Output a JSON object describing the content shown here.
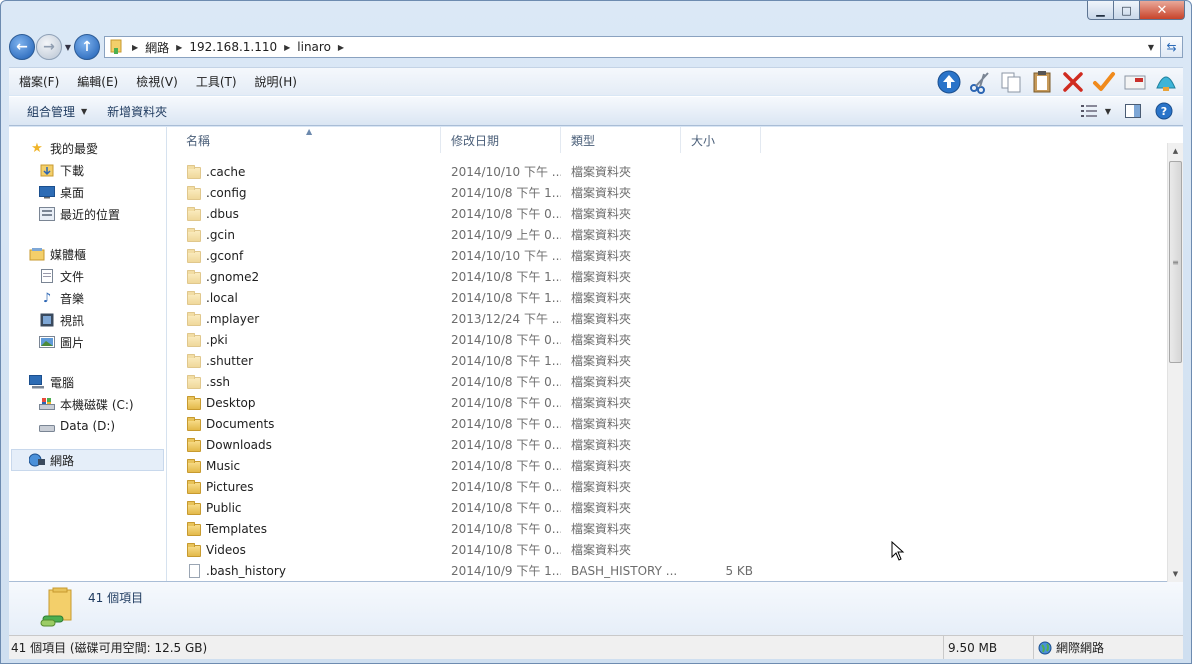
{
  "window": {
    "controls": {
      "minimize": "▁",
      "maximize": "□",
      "close": "✕"
    }
  },
  "address": {
    "crumbs": [
      "網路",
      "192.168.1.110",
      "linaro"
    ]
  },
  "menu": {
    "items": [
      "檔案(F)",
      "編輯(E)",
      "檢視(V)",
      "工具(T)",
      "說明(H)"
    ]
  },
  "toolbar": {
    "icons": [
      "up-arrow-icon",
      "cut-icon",
      "copy-icon",
      "paste-icon",
      "delete-icon",
      "check-icon",
      "mail-icon",
      "shell-icon"
    ]
  },
  "command_bar": {
    "organize": "組合管理",
    "new_folder": "新增資料夾"
  },
  "nav_pane": {
    "favorites": {
      "label": "我的最愛",
      "items": [
        "下載",
        "桌面",
        "最近的位置"
      ]
    },
    "libraries": {
      "label": "媒體櫃",
      "items": [
        "文件",
        "音樂",
        "視訊",
        "圖片"
      ]
    },
    "computer": {
      "label": "電腦",
      "items": [
        "本機磁碟 (C:)",
        "Data (D:)"
      ]
    },
    "network": {
      "label": "網路"
    }
  },
  "columns": {
    "name": "名稱",
    "date": "修改日期",
    "type": "類型",
    "size": "大小"
  },
  "files": [
    {
      "name": ".cache",
      "date": "2014/10/10 下午 ...",
      "type": "檔案資料夾",
      "size": "",
      "kind": "folder-hidden"
    },
    {
      "name": ".config",
      "date": "2014/10/8 下午 1...",
      "type": "檔案資料夾",
      "size": "",
      "kind": "folder-hidden"
    },
    {
      "name": ".dbus",
      "date": "2014/10/8 下午 0...",
      "type": "檔案資料夾",
      "size": "",
      "kind": "folder-hidden"
    },
    {
      "name": ".gcin",
      "date": "2014/10/9 上午 0...",
      "type": "檔案資料夾",
      "size": "",
      "kind": "folder-hidden"
    },
    {
      "name": ".gconf",
      "date": "2014/10/10 下午 ...",
      "type": "檔案資料夾",
      "size": "",
      "kind": "folder-hidden"
    },
    {
      "name": ".gnome2",
      "date": "2014/10/8 下午 1...",
      "type": "檔案資料夾",
      "size": "",
      "kind": "folder-hidden"
    },
    {
      "name": ".local",
      "date": "2014/10/8 下午 1...",
      "type": "檔案資料夾",
      "size": "",
      "kind": "folder-hidden"
    },
    {
      "name": ".mplayer",
      "date": "2013/12/24 下午 ...",
      "type": "檔案資料夾",
      "size": "",
      "kind": "folder-hidden"
    },
    {
      "name": ".pki",
      "date": "2014/10/8 下午 0...",
      "type": "檔案資料夾",
      "size": "",
      "kind": "folder-hidden"
    },
    {
      "name": ".shutter",
      "date": "2014/10/8 下午 1...",
      "type": "檔案資料夾",
      "size": "",
      "kind": "folder-hidden"
    },
    {
      "name": ".ssh",
      "date": "2014/10/8 下午 0...",
      "type": "檔案資料夾",
      "size": "",
      "kind": "folder-hidden"
    },
    {
      "name": "Desktop",
      "date": "2014/10/8 下午 0...",
      "type": "檔案資料夾",
      "size": "",
      "kind": "folder"
    },
    {
      "name": "Documents",
      "date": "2014/10/8 下午 0...",
      "type": "檔案資料夾",
      "size": "",
      "kind": "folder"
    },
    {
      "name": "Downloads",
      "date": "2014/10/8 下午 0...",
      "type": "檔案資料夾",
      "size": "",
      "kind": "folder"
    },
    {
      "name": "Music",
      "date": "2014/10/8 下午 0...",
      "type": "檔案資料夾",
      "size": "",
      "kind": "folder"
    },
    {
      "name": "Pictures",
      "date": "2014/10/8 下午 0...",
      "type": "檔案資料夾",
      "size": "",
      "kind": "folder"
    },
    {
      "name": "Public",
      "date": "2014/10/8 下午 0...",
      "type": "檔案資料夾",
      "size": "",
      "kind": "folder"
    },
    {
      "name": "Templates",
      "date": "2014/10/8 下午 0...",
      "type": "檔案資料夾",
      "size": "",
      "kind": "folder"
    },
    {
      "name": "Videos",
      "date": "2014/10/8 下午 0...",
      "type": "檔案資料夾",
      "size": "",
      "kind": "folder"
    },
    {
      "name": ".bash_history",
      "date": "2014/10/9 下午 1...",
      "type": "BASH_HISTORY ...",
      "size": "5 KB",
      "kind": "file"
    }
  ],
  "details": {
    "count": "41 個項目"
  },
  "status": {
    "summary": "41 個項目 (磁碟可用空間: 12.5 GB)",
    "size": "9.50 MB",
    "zone": "網際網路"
  }
}
